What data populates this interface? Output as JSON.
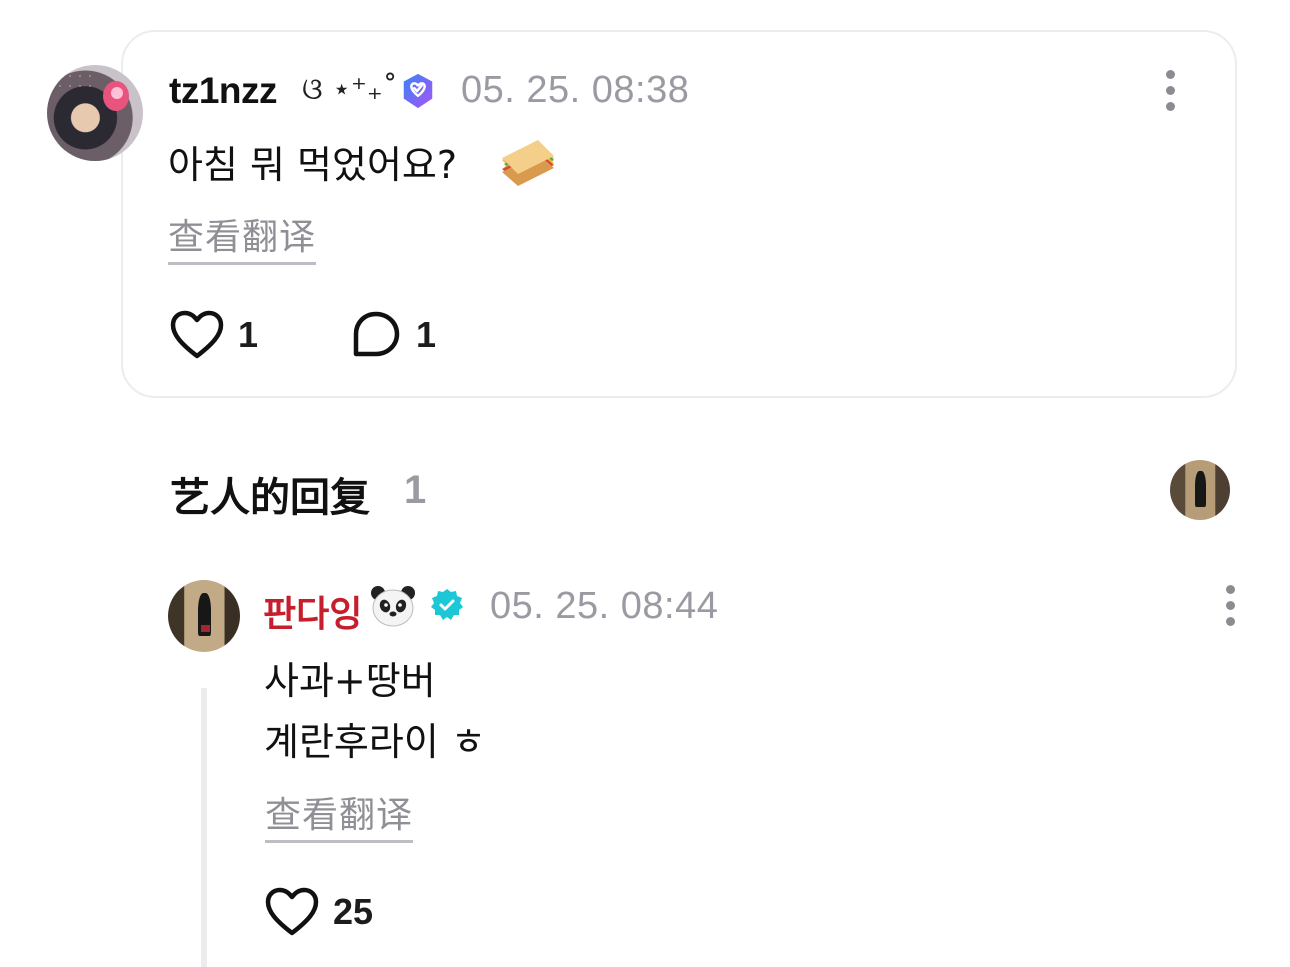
{
  "post": {
    "username": "tz1nzz",
    "username_decoration": "ଓ ⋆⁺₊˚",
    "timestamp": "05. 25. 08:38",
    "text": "아침 뭐 먹었어요?",
    "translate_label": "查看翻译",
    "like_count": "1",
    "comment_count": "1"
  },
  "replies_section": {
    "title": "艺人的回复",
    "count": "1"
  },
  "reply": {
    "author": "판다잉",
    "timestamp": "05. 25. 08:44",
    "line1": "사과+땅버",
    "line2": "계란후라이 ㅎ",
    "translate_label": "查看翻译",
    "like_count": "25"
  },
  "colors": {
    "artist_name": "#c51e2c",
    "fan_badge": "#6b5cf6",
    "artist_badge": "#1cc7d6",
    "muted_text": "#9a9aa2"
  },
  "icons": [
    "fan-verified-badge-icon",
    "artist-verified-badge-icon",
    "more-options-icon",
    "heart-icon",
    "comment-bubble-icon",
    "sandwich-emoji-icon",
    "panda-emoji-icon"
  ]
}
